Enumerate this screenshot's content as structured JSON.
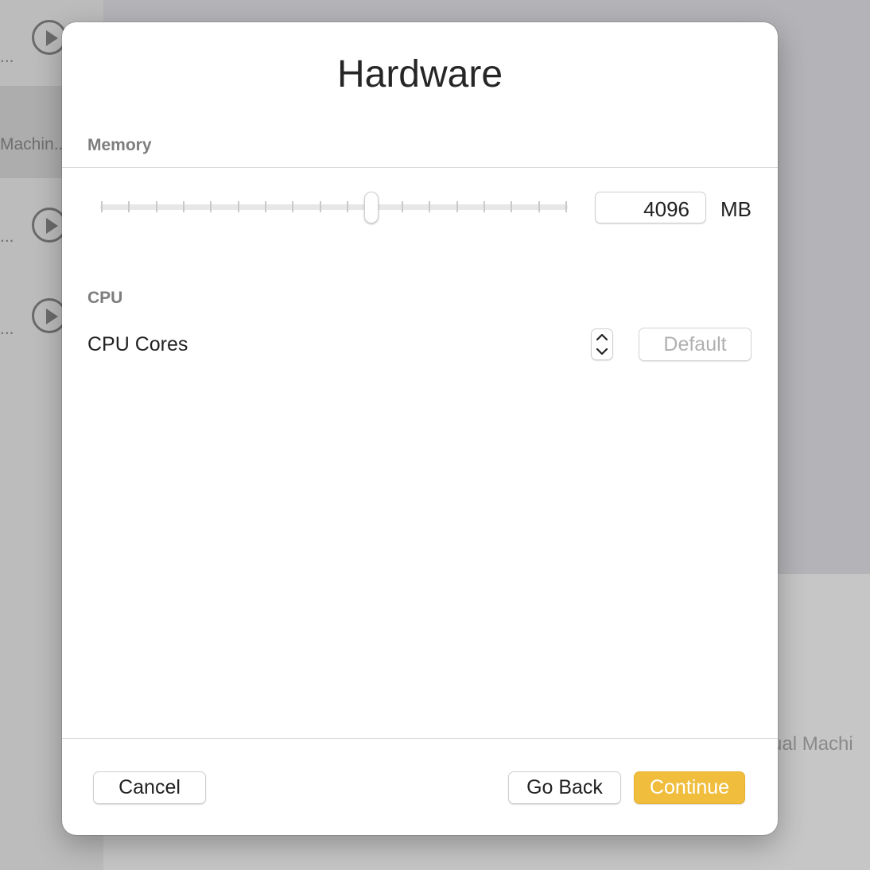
{
  "background": {
    "sidebar_labels": [
      "...",
      "Machin...",
      "...",
      "..."
    ],
    "caption": "ual Machi"
  },
  "dialog": {
    "title": "Hardware",
    "memory": {
      "header": "Memory",
      "value": "4096",
      "unit": "MB",
      "slider_position": 0.58
    },
    "cpu": {
      "header": "CPU",
      "cores_label": "CPU Cores",
      "default_label": "Default"
    },
    "buttons": {
      "cancel": "Cancel",
      "go_back": "Go Back",
      "continue": "Continue"
    }
  },
  "colors": {
    "accent": "#f0be3c"
  }
}
